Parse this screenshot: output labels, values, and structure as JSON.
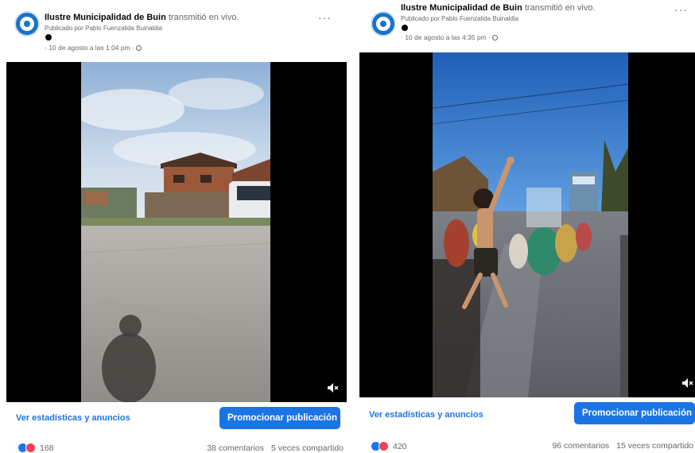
{
  "posts": [
    {
      "page_name": "Ilustre Municipalidad de Buin",
      "action": "transmitió en vivo.",
      "published_by": "Publicado por Pablo Fuenzalida Buinaldia",
      "date": "· 10 de agosto a las 1:04 pm ·",
      "more_label": "···",
      "stats_link": "Ver estadísticas y anuncios",
      "promote_label": "Promocionar publicación",
      "reactions_count": "168",
      "comments": "38 comentarios",
      "shares": "5 veces compartido"
    },
    {
      "page_name": "Ilustre Municipalidad de Buin",
      "action": "transmitió en vivo.",
      "published_by": "Publicado por Pablo Fuenzalida Buinaldia",
      "date": "· 10 de agosto a las 4:35 pm ·",
      "more_label": "···",
      "stats_link": "Ver estadísticas y anuncios",
      "promote_label": "Promocionar publicación",
      "reactions_count": "420",
      "comments": "96 comentarios",
      "shares": "15 veces compartido"
    }
  ],
  "icons": {
    "avatar": "municipality-logo-icon",
    "globe": "globe-icon",
    "mute": "volume-muted-icon",
    "like": "like-reaction-icon",
    "love": "love-reaction-icon"
  },
  "colors": {
    "link": "#1b74e4",
    "button": "#1b74e4",
    "like": "#1877f2",
    "love": "#f33e58"
  }
}
